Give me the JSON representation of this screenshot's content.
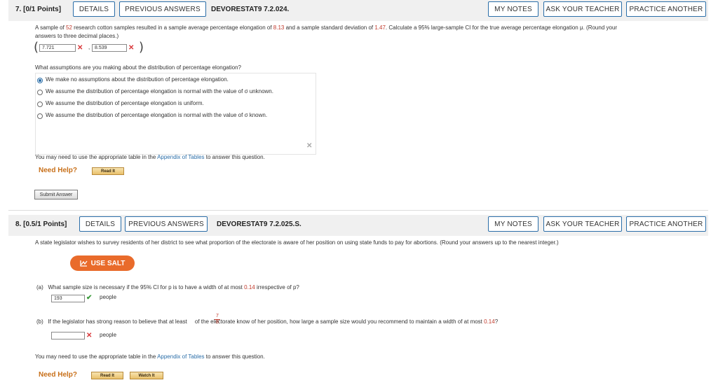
{
  "q7": {
    "number": "7.",
    "points": "[0/1 Points]",
    "details": "DETAILS",
    "previous_answers": "PREVIOUS ANSWERS",
    "code": "DEVORESTAT9 7.2.024.",
    "my_notes": "MY NOTES",
    "ask_teacher": "ASK YOUR TEACHER",
    "practice_another": "PRACTICE ANOTHER",
    "problem": {
      "t1": "A sample of ",
      "n": "52",
      "t2": " research cotton samples resulted in a sample average percentage elongation of ",
      "mean": "8.13",
      "t3": " and a sample standard deviation of ",
      "sd": "1.47",
      "t4": ". Calculate a 95% large-sample CI for the true average percentage elongation μ. (Round your",
      "t5": "answers to three decimal places.)"
    },
    "lower_value": "7.721",
    "upper_value": "8.539",
    "paren_open": "(",
    "paren_close": ")",
    "comma": ",",
    "cross": "✕",
    "assumption_question": "What assumptions are you making about the distribution of percentage elongation?",
    "options": [
      "We make no assumptions about the distribution of percentage elongation.",
      "We assume the distribution of percentage elongation is normal with the value of σ unknown.",
      "We assume the distribution of percentage elongation is uniform.",
      "We assume the distribution of percentage elongation is normal with the value of σ known."
    ],
    "selected_option": 0,
    "tables_text_1": "You may need to use the appropriate table in the ",
    "tables_link": "Appendix of Tables",
    "tables_text_2": " to answer this question.",
    "need_help": "Need Help?",
    "read_it": "Read It",
    "submit": "Submit Answer"
  },
  "q8": {
    "number": "8.",
    "points": "[0.5/1 Points]",
    "details": "DETAILS",
    "previous_answers": "PREVIOUS ANSWERS",
    "code": "DEVORESTAT9 7.2.025.S.",
    "my_notes": "MY NOTES",
    "ask_teacher": "ASK YOUR TEACHER",
    "practice_another": "PRACTICE ANOTHER",
    "problem": "A state legislator wishes to survey residents of her district to see what proportion of the electorate is aware of her position on using state funds to pay for abortions. (Round your answers up to the nearest integer.)",
    "use_salt": "USE SALT",
    "part_a": {
      "label": "(a)",
      "t1": "What sample size is necessary if the 95% CI for p is to have a width of at most ",
      "width": "0.14",
      "t2": " irrespective of p?",
      "value": "193",
      "unit": "people"
    },
    "part_b": {
      "label": "(b)",
      "t1": "If the legislator has strong reason to believe that at least ",
      "frac_num": "7",
      "frac_den": "8",
      "t2": " of the electorate know of her position, how large a sample size would you recommend to maintain a width of at most ",
      "width": "0.14",
      "t3": "?",
      "value": "",
      "unit": "people"
    },
    "tables_text_1": "You may need to use the appropriate table in the ",
    "tables_link": "Appendix of Tables",
    "tables_text_2": " to answer this question.",
    "need_help": "Need Help?",
    "read_it": "Read It",
    "watch_it": "Watch It"
  },
  "colors": {
    "accent": "#2b6ea8",
    "salt": "#e96b2b",
    "incorrect": "#d9383a",
    "correct": "#3c9b3c",
    "help": "#c8701a"
  }
}
